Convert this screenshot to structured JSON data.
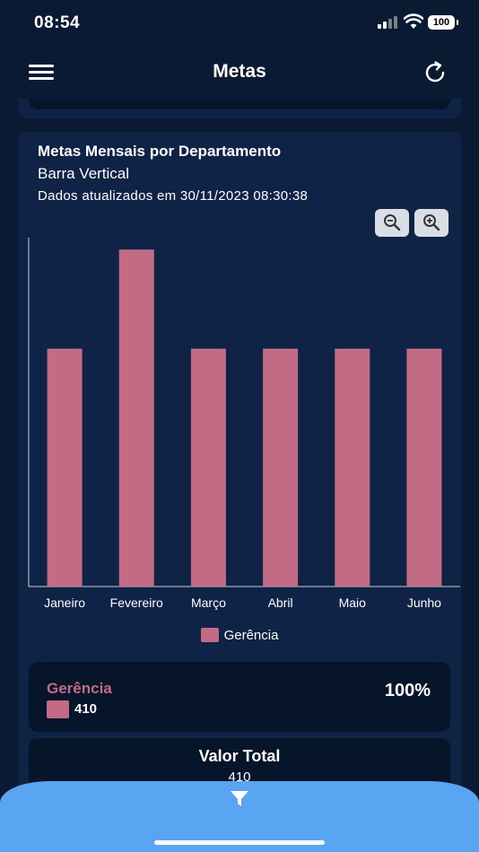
{
  "status_bar": {
    "time": "08:54",
    "battery": "100"
  },
  "header": {
    "title": "Metas"
  },
  "chart_card": {
    "title": "Metas Mensais por Departamento",
    "subtitle": "Barra Vertical",
    "updated": "Dados atualizados em 30/11/2023 08:30:38"
  },
  "chart_data": {
    "type": "bar",
    "categories": [
      "Janeiro",
      "Fevereiro",
      "Março",
      "Abril",
      "Maio",
      "Junho"
    ],
    "series": [
      {
        "name": "Gerência",
        "values": [
          60,
          85,
          60,
          60,
          60,
          60
        ],
        "color": "#c26b85"
      }
    ],
    "ylim": [
      0,
      88
    ],
    "grid": false,
    "legend": "bottom"
  },
  "summary": {
    "name": "Gerência",
    "value": "410",
    "percent": "100%",
    "color": "#c26b85"
  },
  "total": {
    "label": "Valor Total",
    "value": "410"
  },
  "colors": {
    "background": "#0b1a33",
    "card": "#0f2347",
    "inner_card": "#07152b",
    "accent": "#5aa5f2"
  },
  "icons": [
    "menu-icon",
    "refresh-icon",
    "zoom-out-icon",
    "zoom-in-icon",
    "filter-icon"
  ]
}
